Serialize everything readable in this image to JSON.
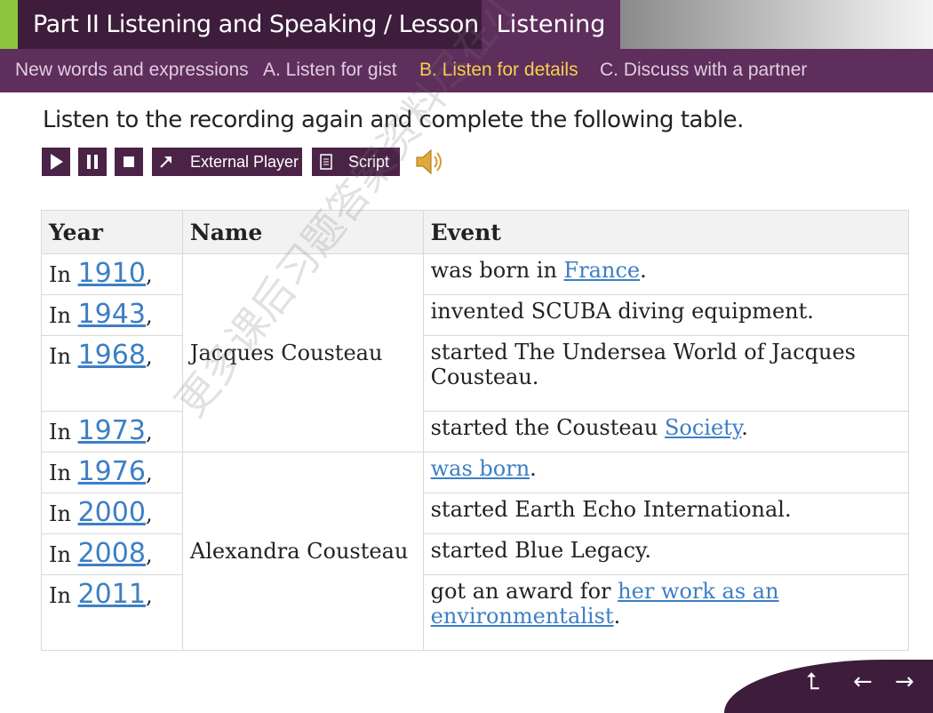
{
  "header": {
    "title": "Part II Listening  and Speaking / Lesson A",
    "active_tab": "Listening"
  },
  "subnav": [
    {
      "label": "New words and expressions",
      "active": false
    },
    {
      "label": "A. Listen for gist",
      "active": false
    },
    {
      "label": "B. Listen for details",
      "active": true
    },
    {
      "label": "C. Discuss with a partner",
      "active": false
    }
  ],
  "instruction": "Listen to the recording again and complete the following table.",
  "controls": {
    "external_player": "External Player",
    "script": "Script"
  },
  "table": {
    "headers": [
      "Year",
      "Name",
      "Event"
    ],
    "groups": [
      {
        "name": "Jacques Cousteau",
        "rows": [
          {
            "prefix": "In ",
            "year": "1910",
            "comma": ",",
            "event_before": "was born in ",
            "answer": "France",
            "event_after": "."
          },
          {
            "prefix": "In ",
            "year": "1943",
            "comma": ",",
            "event_before": "invented SCUBA diving equipment.",
            "answer": "",
            "event_after": ""
          },
          {
            "prefix": "In ",
            "year": "1968",
            "comma": ",",
            "event_before": "started The Undersea World of Jacques Cousteau.",
            "answer": "",
            "event_after": ""
          },
          {
            "prefix": "In ",
            "year": "1973",
            "comma": ",",
            "event_before": "started the Cousteau ",
            "answer": "Society",
            "event_after": "."
          }
        ]
      },
      {
        "name": "Alexandra Cousteau",
        "rows": [
          {
            "prefix": "In ",
            "year": "1976",
            "comma": ",",
            "event_before": "",
            "answer": "was born",
            "event_after": "."
          },
          {
            "prefix": "In ",
            "year": "2000",
            "comma": ",",
            "event_before": "started Earth Echo International.",
            "answer": "",
            "event_after": ""
          },
          {
            "prefix": "In ",
            "year": "2008",
            "comma": ",",
            "event_before": "started Blue Legacy.",
            "answer": "",
            "event_after": ""
          },
          {
            "prefix": "In ",
            "year": "2011",
            "comma": ",",
            "event_before": "got an award for ",
            "answer": "her work as an environmentalist",
            "event_after": "."
          }
        ]
      }
    ]
  },
  "watermark": "更多课后习题答案资料尽在小程序",
  "nav": {
    "up": "⮤",
    "back": "←",
    "forward": "→"
  },
  "colors": {
    "dark_purple": "#3d1d3b",
    "purple": "#5e2e5c",
    "accent_green": "#8dc63f",
    "highlight_yellow": "#f6d04d",
    "link_blue": "#3d7fc4"
  }
}
